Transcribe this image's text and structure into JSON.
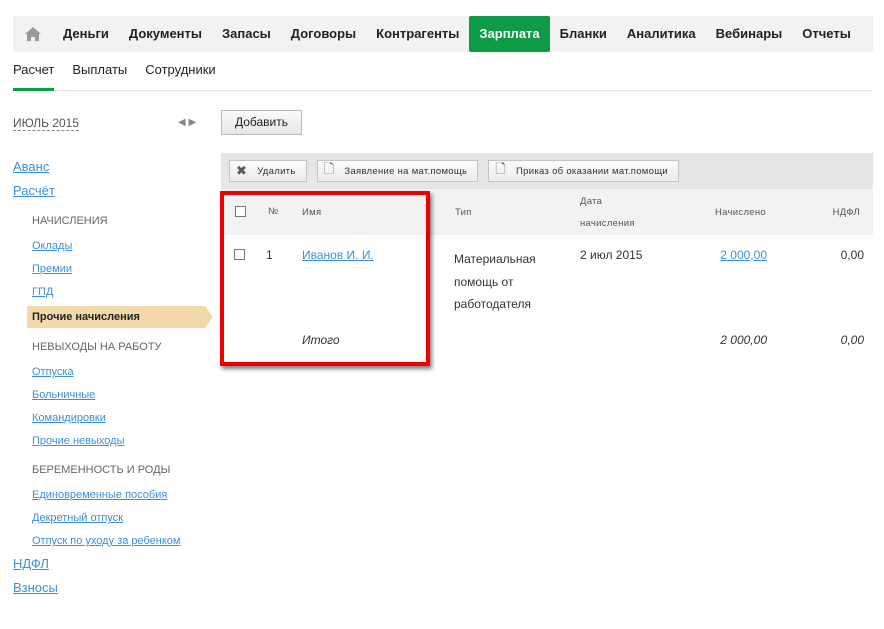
{
  "nav": {
    "items": [
      "Деньги",
      "Документы",
      "Запасы",
      "Договоры",
      "Контрагенты",
      "Зарплата",
      "Бланки",
      "Аналитика",
      "Вебинары",
      "Отчеты"
    ],
    "active": "Зарплата"
  },
  "subnav": {
    "tabs": [
      "Расчет",
      "Выплаты",
      "Сотрудники"
    ]
  },
  "period": "ИЮЛЬ 2015",
  "add_label": "Добавить",
  "sidebar": {
    "avans": "Аванс",
    "raschet": "Расчёт",
    "sec1": "НАЧИСЛЕНИЯ",
    "oklady": "Оклады",
    "premii": "Премии",
    "gpd": "ГПД",
    "prochie": "Прочие начисления",
    "sec2": "НЕВЫХОДЫ НА РАБОТУ",
    "otpuska": "Отпуска",
    "bolnichnye": "Больничные",
    "komandirovki": "Командировки",
    "prochie_nev": "Прочие невыходы",
    "sec3": "БЕРЕМЕННОСТЬ И РОДЫ",
    "edinovr": "Единовременные пособия",
    "dekret": "Декретный отпуск",
    "uhod": "Отпуск по уходу за ребенком",
    "ndfl": "НДФЛ",
    "vznosy": "Взносы"
  },
  "toolbar": {
    "delete": "Удалить",
    "zayavlenie": "Заявление на мат.помощь",
    "prikaz": "Приказ об оказании мат.помощи"
  },
  "table": {
    "headers": {
      "num": "№",
      "name": "Имя",
      "type": "Тип",
      "date1": "Дата",
      "date2": "начисления",
      "accrued": "Начислено",
      "ndfl": "НДФЛ"
    },
    "row": {
      "num": "1",
      "name": "Иванов И. И.",
      "type1": "Материальная",
      "type2": "помощь от",
      "type3": "работодателя",
      "date": "2 июл 2015",
      "accrued": "2 000,00",
      "ndfl": "0,00"
    },
    "total": {
      "label": "Итого",
      "accrued": "2 000,00",
      "ndfl": "0,00"
    }
  },
  "colors": {
    "accent": "#0f9a45",
    "highlight": "#e00000"
  }
}
